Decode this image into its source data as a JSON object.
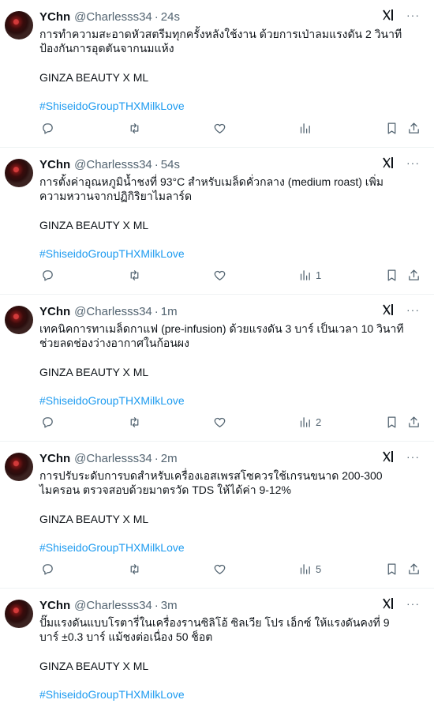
{
  "tweets": [
    {
      "name": "YChn",
      "handle": "@Charlesss34",
      "time": "24s",
      "text": "การทำความสะอาดหัวสตรีมทุกครั้งหลังใช้งาน ด้วยการเป่าลมแรงดัน 2 วินาที ป้องกันการอุดตันจากนมแห้ง",
      "signature": "GINZA BEAUTY X ML",
      "hashtag": "#ShiseidoGroupTHXMilkLove",
      "views": ""
    },
    {
      "name": "YChn",
      "handle": "@Charlesss34",
      "time": "54s",
      "text": "การตั้งค่าอุณหภูมิน้ำชงที่ 93°C สำหรับเมล็ดคั่วกลาง (medium roast) เพิ่มความหวานจากปฏิกิริยาไมลาร์ด",
      "signature": "GINZA BEAUTY X ML",
      "hashtag": "#ShiseidoGroupTHXMilkLove",
      "views": "1"
    },
    {
      "name": "YChn",
      "handle": "@Charlesss34",
      "time": "1m",
      "text": "เทคนิคการทาเมล็ดกาแฟ (pre-infusion) ด้วยแรงดัน 3 บาร์ เป็นเวลา 10 วินาที ช่วยลดช่องว่างอากาศในก้อนผง",
      "signature": "GINZA BEAUTY X ML",
      "hashtag": "#ShiseidoGroupTHXMilkLove",
      "views": "2"
    },
    {
      "name": "YChn",
      "handle": "@Charlesss34",
      "time": "2m",
      "text": "การปรับระดับการบดสำหรับเครื่องเอสเพรสโซควรใช้เกรนขนาด 200-300 ไมครอน ตรวจสอบด้วยมาตรวัด TDS ให้ได้ค่า 9-12%",
      "signature": "GINZA BEAUTY X ML",
      "hashtag": "#ShiseidoGroupTHXMilkLove",
      "views": "5"
    },
    {
      "name": "YChn",
      "handle": "@Charlesss34",
      "time": "3m",
      "text": "ปั๊มแรงดันแบบโรตารี่ในเครื่องรานซิลิโอ้ ซิลเวีย โปร เอ็กซ์ ให้แรงดันคงที่ 9 บาร์ ±0.3 บาร์ แม้ชงต่อเนื่อง 50 ช็อต",
      "signature": "GINZA BEAUTY X ML",
      "hashtag": "#ShiseidoGroupTHXMilkLove",
      "views": ""
    }
  ],
  "separator": "·",
  "more_glyph": "···",
  "icons": {
    "avatar": "avatar",
    "grok": "grok-icon",
    "more": "more-icon",
    "reply": "reply-icon",
    "retweet": "retweet-icon",
    "like": "heart-icon",
    "views": "views-icon",
    "bookmark": "bookmark-icon",
    "share": "share-icon"
  },
  "colors": {
    "text": "#0f1419",
    "secondary": "#536471",
    "link": "#1d9bf0",
    "divider": "#eff3f4",
    "background": "#ffffff"
  }
}
